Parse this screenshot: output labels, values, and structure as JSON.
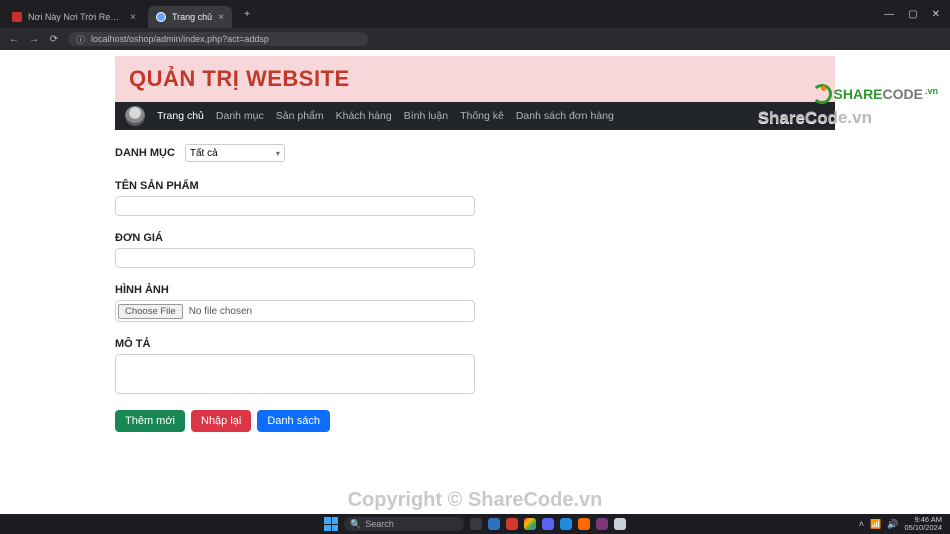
{
  "browser": {
    "tabs": [
      {
        "title": "Nơi Này Nơi Trời Renou | d…"
      },
      {
        "title": "Trang chủ"
      }
    ],
    "url": "localhost/oshop/admin/index.php?act=addsp"
  },
  "page": {
    "banner_title": "QUẢN TRỊ WEBSITE",
    "nav": {
      "items": [
        "Trang chủ",
        "Danh mục",
        "Sản phẩm",
        "Khách hàng",
        "Bình luận",
        "Thống kê",
        "Danh sách đơn hàng"
      ],
      "active_index": 0
    },
    "form": {
      "category_label": "DANH MỤC",
      "category_value": "Tất cả",
      "name_label": "TÊN SẢN PHẨM",
      "price_label": "ĐƠN GIÁ",
      "image_label": "HÌNH ẢNH",
      "choose_file_btn": "Choose File",
      "no_file_text": "No file chosen",
      "desc_label": "MÔ TẢ",
      "buttons": {
        "add": "Thêm mới",
        "reset": "Nhập lại",
        "list": "Danh sách"
      }
    }
  },
  "watermark": {
    "top": "ShareCode.vn",
    "bottom": "Copyright © ShareCode.vn",
    "logo_share": "SHARE",
    "logo_code": "CODE",
    "logo_vn": ".vn"
  },
  "taskbar": {
    "search_placeholder": "Search",
    "time": "9:46 AM",
    "date": "05/10/2024"
  }
}
